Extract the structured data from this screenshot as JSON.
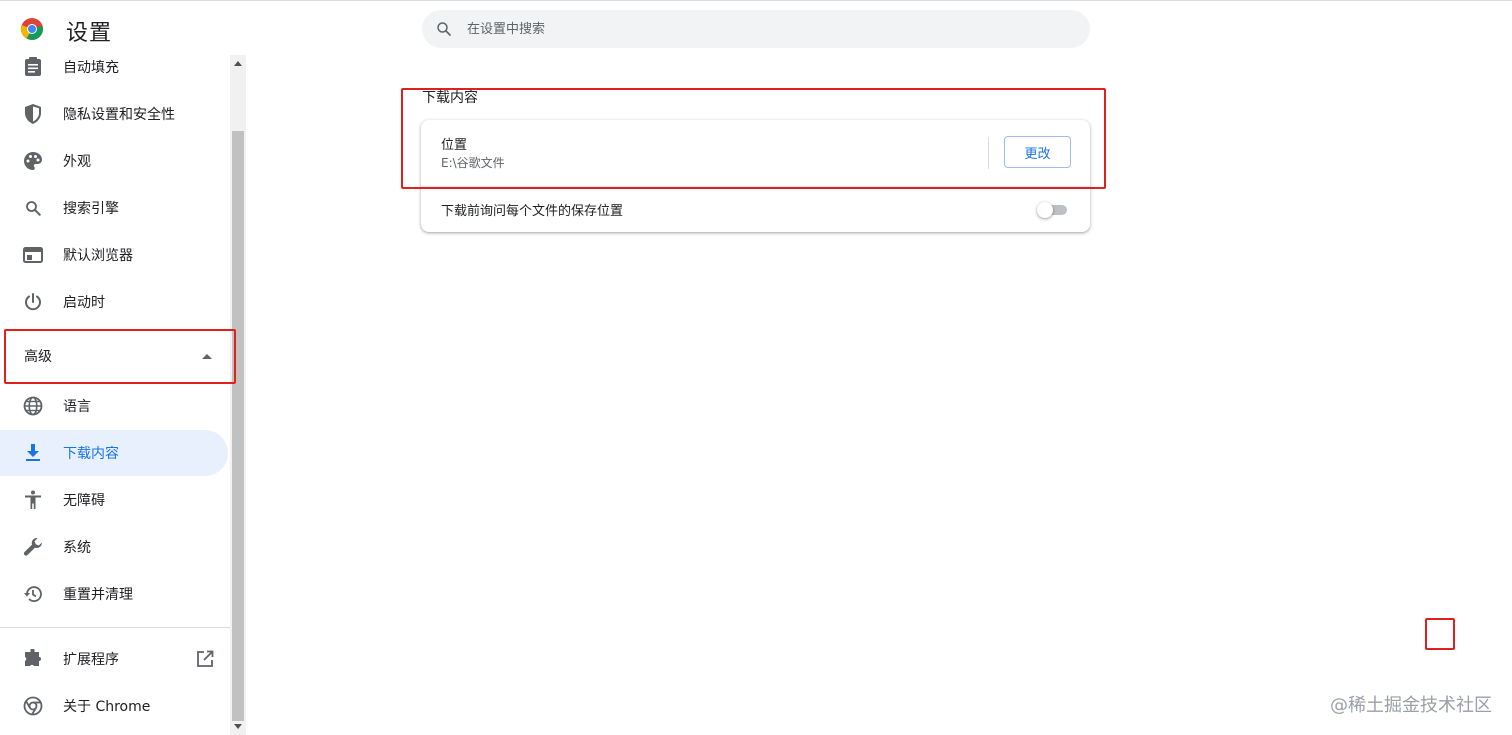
{
  "header": {
    "title": "设置",
    "search_placeholder": "在设置中搜索"
  },
  "sidebar": {
    "items_top": [
      {
        "label": "自动填充",
        "icon": "clipboard-icon"
      },
      {
        "label": "隐私设置和安全性",
        "icon": "shield-icon"
      },
      {
        "label": "外观",
        "icon": "palette-icon"
      },
      {
        "label": "搜索引擎",
        "icon": "search-icon"
      },
      {
        "label": "默认浏览器",
        "icon": "browser-window-icon"
      },
      {
        "label": "启动时",
        "icon": "power-icon"
      }
    ],
    "advanced_label": "高级",
    "items_advanced": [
      {
        "label": "语言",
        "icon": "globe-icon"
      },
      {
        "label": "下载内容",
        "icon": "download-icon",
        "active": true
      },
      {
        "label": "无障碍",
        "icon": "accessibility-icon"
      },
      {
        "label": "系统",
        "icon": "wrench-icon"
      },
      {
        "label": "重置并清理",
        "icon": "history-icon"
      }
    ],
    "items_bottom": [
      {
        "label": "扩展程序",
        "icon": "puzzle-icon"
      },
      {
        "label": "关于 Chrome",
        "icon": "chrome-icon"
      }
    ]
  },
  "main": {
    "section_title": "下载内容",
    "location_label": "位置",
    "location_value": "E:\\谷歌文件",
    "change_button": "更改",
    "ask_where_label": "下载前询问每个文件的保存位置",
    "ask_where_enabled": false
  },
  "watermark": "@稀土掘金技术社区",
  "colors": {
    "accent": "#1a73e8",
    "active_bg": "#e8f0fe",
    "annotation_red": "#e0201c"
  }
}
